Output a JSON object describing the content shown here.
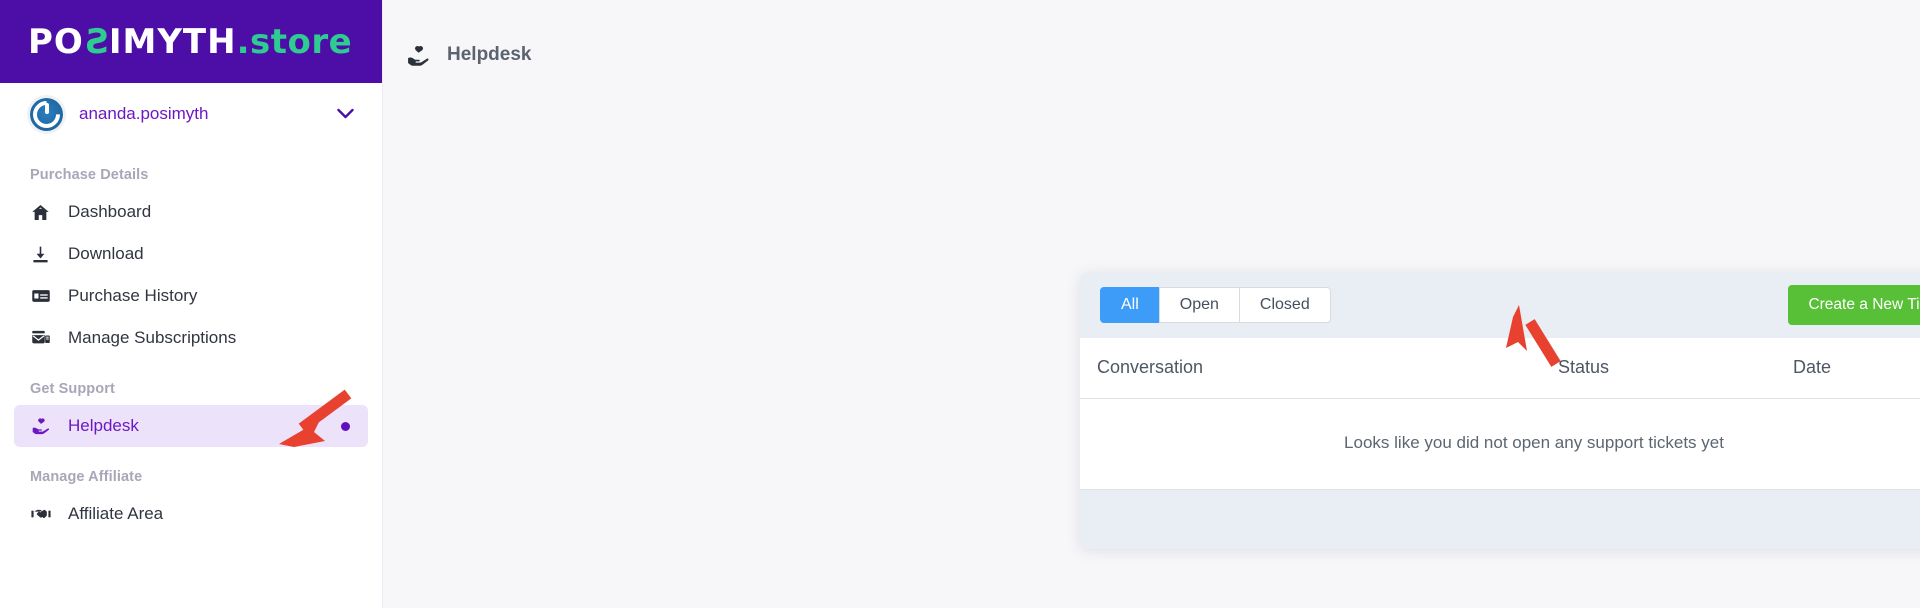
{
  "brand": {
    "name_primary": "POSIMYTH",
    "name_accent": ".store"
  },
  "account": {
    "name": "ananda.posimyth",
    "chevron": "chevron-down"
  },
  "sidebar": {
    "groups": [
      {
        "heading": "Purchase Details",
        "items": [
          {
            "label": "Dashboard",
            "icon": "home-icon",
            "active": false
          },
          {
            "label": "Download",
            "icon": "download-icon",
            "active": false
          },
          {
            "label": "Purchase History",
            "icon": "credit-card-icon",
            "active": false
          },
          {
            "label": "Manage Subscriptions",
            "icon": "subscription-icon",
            "active": false
          }
        ]
      },
      {
        "heading": "Get Support",
        "items": [
          {
            "label": "Helpdesk",
            "icon": "hand-heart-icon",
            "active": true,
            "dot": true
          }
        ]
      },
      {
        "heading": "Manage Affiliate",
        "items": [
          {
            "label": "Affiliate Area",
            "icon": "handshake-icon",
            "active": false
          }
        ]
      }
    ]
  },
  "main": {
    "page_title": "Helpdesk",
    "page_icon": "hand-heart-icon"
  },
  "card": {
    "tabs": [
      {
        "label": "All",
        "active": true
      },
      {
        "label": "Open",
        "active": false
      },
      {
        "label": "Closed",
        "active": false
      }
    ],
    "create_button": "Create a New Ticket",
    "table": {
      "columns": [
        "Conversation",
        "Status",
        "Date"
      ],
      "rows": [],
      "empty_message": "Looks like you did not open any support tickets yet"
    }
  },
  "colors": {
    "brand_purple": "#4d0ea8",
    "brand_green": "#2fcc92",
    "active_nav_bg": "#ece2f9",
    "active_nav_text": "#6d18c4",
    "tab_active": "#3d9cf7",
    "create_button": "#57c036",
    "card_header_bg": "#e9edf4",
    "annotation_arrow": "#e8412f"
  },
  "annotations": [
    {
      "name": "arrow-to-helpdesk",
      "color": "#e8412f"
    },
    {
      "name": "arrow-to-create-ticket",
      "color": "#e8412f"
    }
  ]
}
